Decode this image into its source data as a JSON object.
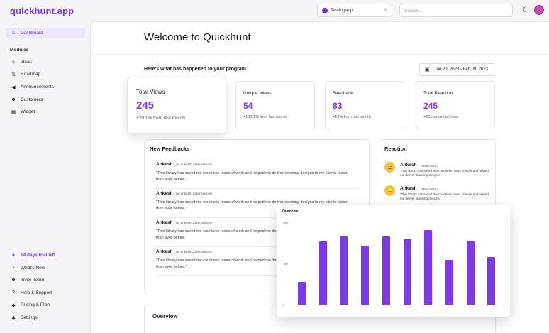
{
  "app": {
    "logo": "quickhunt.app"
  },
  "topbar": {
    "project": "Testingapp",
    "search_placeholder": "Search...",
    "moon_icon": "moon-icon",
    "avatar_icon": "avatar"
  },
  "sidebar": {
    "dashboard": "Dashboard",
    "modules_title": "Modules",
    "items": [
      {
        "label": "Ideas",
        "icon": "lightbulb-icon"
      },
      {
        "label": "Roadmap",
        "icon": "roadmap-icon"
      },
      {
        "label": "Announcements",
        "icon": "megaphone-icon"
      },
      {
        "label": "Customers",
        "icon": "users-icon"
      },
      {
        "label": "Widget",
        "icon": "widget-icon"
      }
    ],
    "bottom": [
      {
        "label": "14 days trial left",
        "icon": "rocket-icon"
      },
      {
        "label": "What's New",
        "icon": "bell-icon"
      },
      {
        "label": "Invite Team",
        "icon": "users-icon"
      },
      {
        "label": "Help & Support",
        "icon": "help-icon"
      },
      {
        "label": "Pricing & Plan",
        "icon": "tag-icon"
      },
      {
        "label": "Settings",
        "icon": "gear-icon"
      }
    ]
  },
  "main": {
    "title": "Welcome to Quickhunt",
    "subtitle": "Here's what has happened to your program",
    "date_range": "Jan 20, 2023 - Feb 09, 2023"
  },
  "stats": [
    {
      "label": "Total Views",
      "value": "245",
      "sub": "+20.1% from last month"
    },
    {
      "label": "Unique Views",
      "value": "54",
      "sub": "+180.1% from last month"
    },
    {
      "label": "Feedback",
      "value": "83",
      "sub": "+19% from last month"
    },
    {
      "label": "Total Reaction",
      "value": "245",
      "sub": "+201 since last hour"
    }
  ],
  "feedbacks": {
    "title": "New Feedbacks",
    "items": [
      {
        "name": "Ankesh",
        "email": "wc.ankesh12@gmail.com",
        "text": "\"This library has saved me countless hours of work and helped me deliver stunning designs to my clients faster than ever before.\""
      },
      {
        "name": "Ankesh",
        "email": "wc.ankesh12@gmail.com",
        "text": "\"This library has saved me countless hours of work and helped me deliver stunning designs to my clients faster than ever before.\""
      },
      {
        "name": "Ankesh",
        "email": "wc.ankesh12@gmail.com",
        "text": "\"This library has saved me countless hours of work and helped me deliver stunning designs to my clients faster than ever before.\""
      },
      {
        "name": "Ankesh",
        "email": "wc.ankesh12@gmail.com",
        "text": "\"This library has saved me countless hours of work and helped me deliver stunning designs to my clients faster than ever before.\""
      }
    ]
  },
  "reaction": {
    "title": "Reaction",
    "items": [
      {
        "name": "Ankesh",
        "reacted": "Reacted to",
        "text": "\"This library has saved me countless hours of work and helped me deliver stunning designs",
        "emoji": "😄"
      },
      {
        "name": "Ankesh",
        "reacted": "Reacted to",
        "text": "\"This library has saved me countless hours of work and helped me deliver stunning designs",
        "emoji": "😑"
      }
    ]
  },
  "overview_section": {
    "title": "Overview"
  },
  "chart_data": {
    "type": "bar",
    "title": "Overview",
    "ylim": [
      0,
      300
    ],
    "yticks": [
      "300",
      "150",
      "0"
    ],
    "values": [
      85,
      232,
      250,
      217,
      251,
      240,
      275,
      166,
      232,
      176
    ],
    "color": "#7c3aed"
  }
}
